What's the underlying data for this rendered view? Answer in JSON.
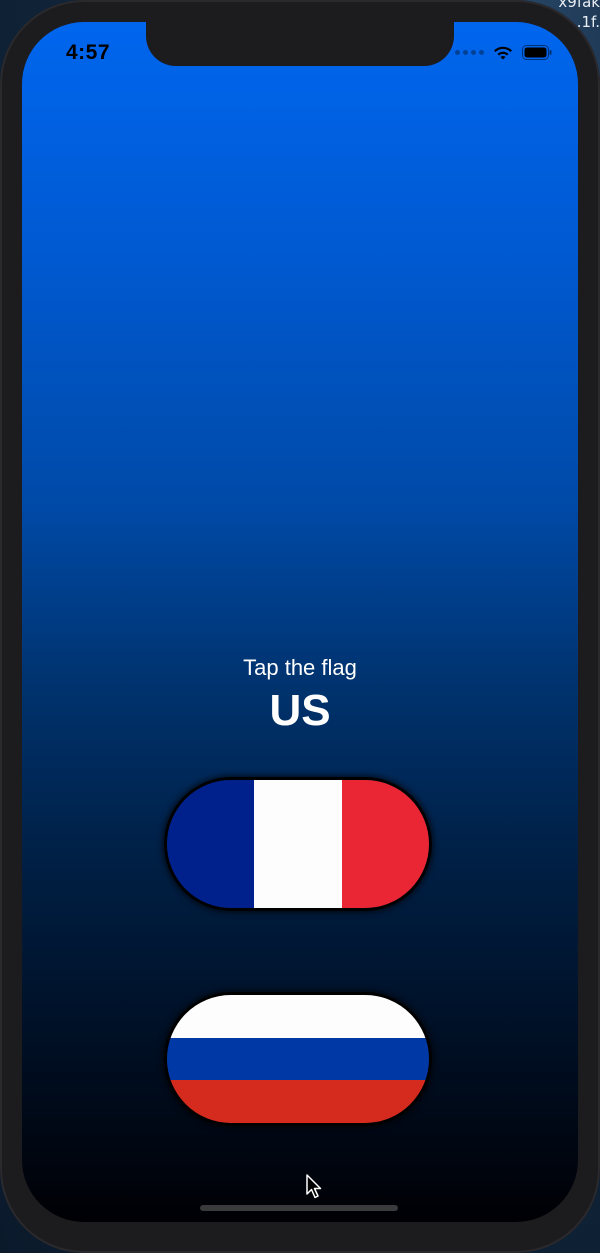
{
  "desktop": {
    "corner_text_line1": "x9fak",
    "corner_text_line2": ".1f."
  },
  "status_bar": {
    "time": "4:57",
    "icons": [
      "signal-dots-icon",
      "wifi-icon",
      "battery-icon"
    ]
  },
  "game": {
    "prompt": "Tap the flag",
    "target_country": "US",
    "flags": [
      {
        "name": "france",
        "orientation": "vertical-stripes",
        "colors": [
          "#00208c",
          "#fdfdfd",
          "#ea2635"
        ]
      },
      {
        "name": "russia",
        "orientation": "horizontal-stripes",
        "colors": [
          "#fdfdfd",
          "#0039a6",
          "#d52b1e"
        ]
      }
    ]
  },
  "colors": {
    "background_top": "#0066ee",
    "background_bottom": "#000004"
  }
}
